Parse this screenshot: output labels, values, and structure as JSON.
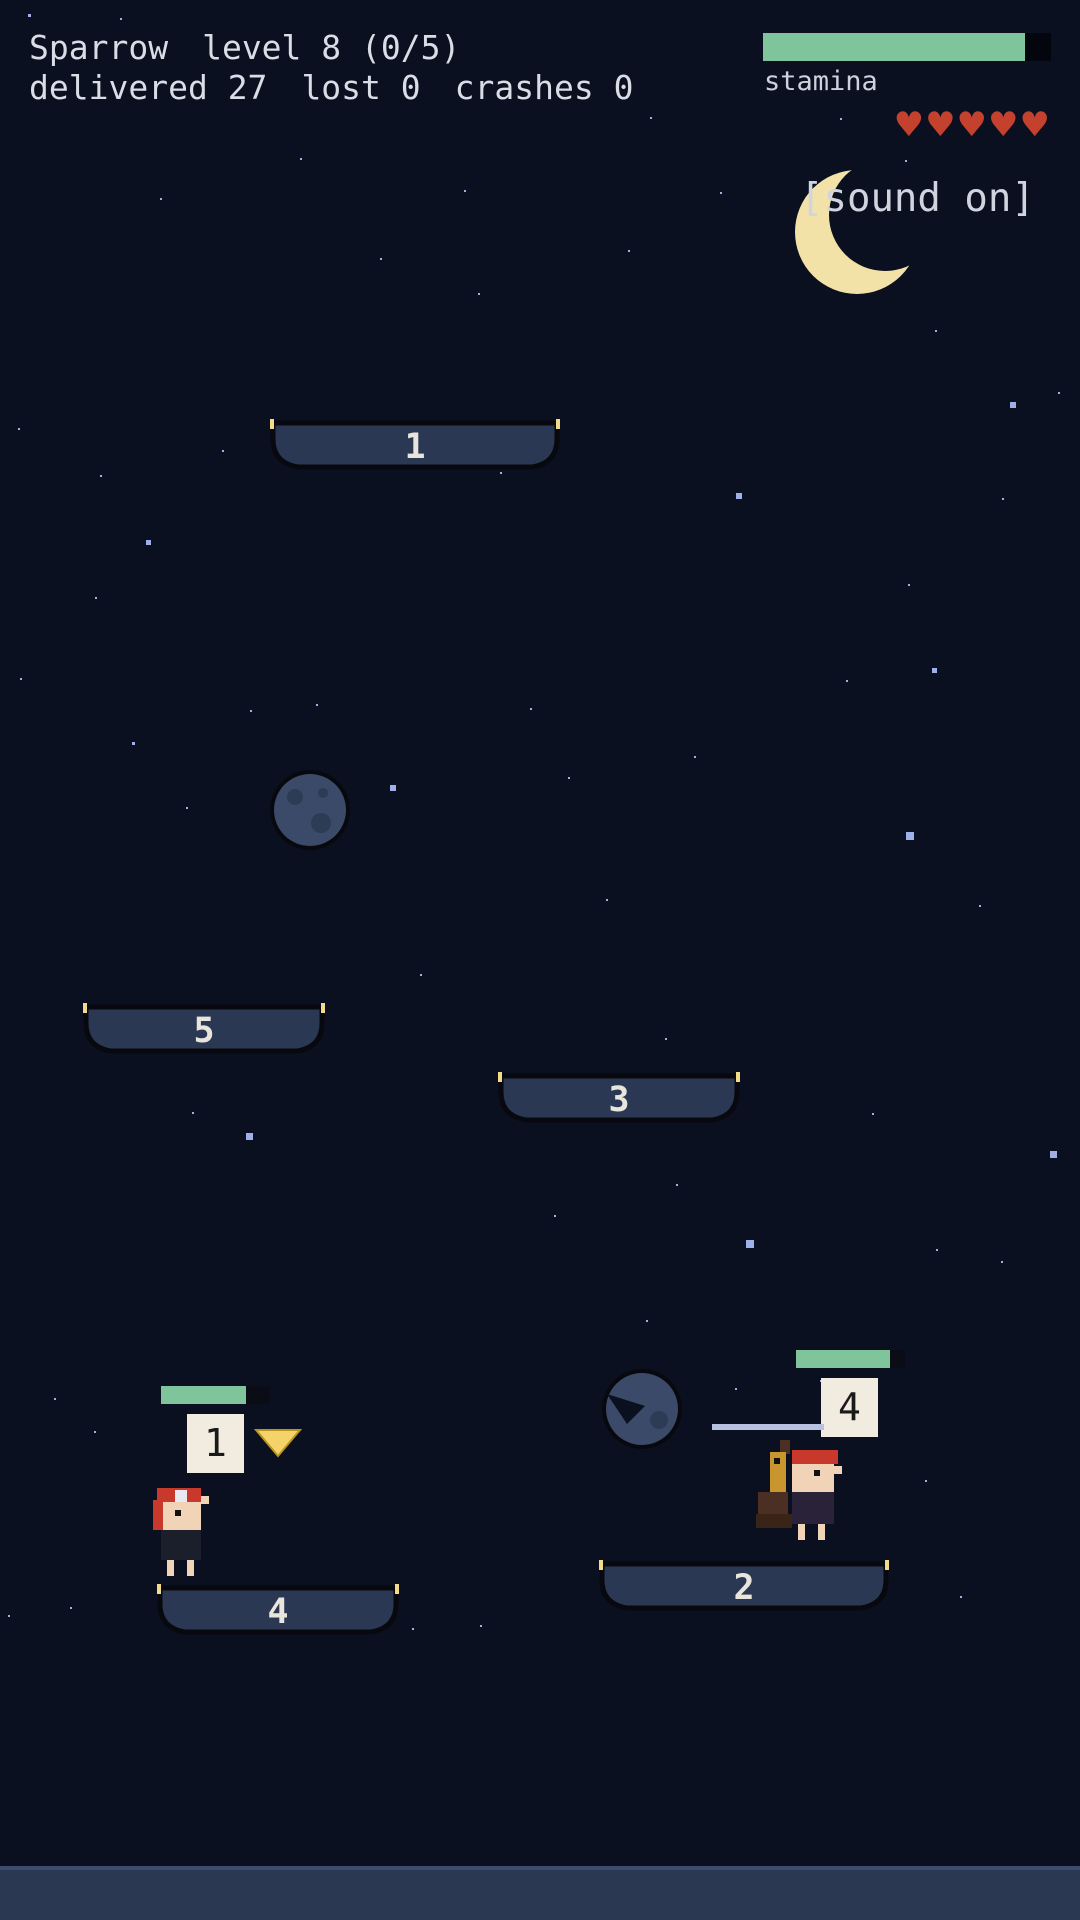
{
  "hud": {
    "bird_name": "Sparrow",
    "level_text": "level 8 (0/5)",
    "delivered_label": "delivered",
    "delivered_value": "27",
    "lost_label": "lost",
    "lost_value": "0",
    "crashes_label": "crashes",
    "crashes_value": "0",
    "stamina_label": "stamina",
    "stamina_level": 0.91,
    "hearts": [
      "♥",
      "♥",
      "♥",
      "♥",
      "♥"
    ],
    "sound_toggle": "[sound on]"
  },
  "platforms": [
    {
      "number": "1"
    },
    {
      "number": "5"
    },
    {
      "number": "3"
    },
    {
      "number": "4"
    },
    {
      "number": "2"
    }
  ],
  "customers": [
    {
      "parcel_number": "1",
      "patience_level": 0.78
    },
    {
      "parcel_number": "4",
      "patience_level": 0.86
    }
  ],
  "colors": {
    "background": "#0b1020",
    "platform": "#2b3853",
    "stamina": "#7fc49a",
    "heart": "#c4412e",
    "moon": "#f3e2a8",
    "parcel": "#f2ece0"
  },
  "icons": {
    "moon": "crescent-moon-icon",
    "heart": "heart-icon",
    "meteor": "meteor-rock-icon",
    "pointer": "down-triangle-icon"
  }
}
